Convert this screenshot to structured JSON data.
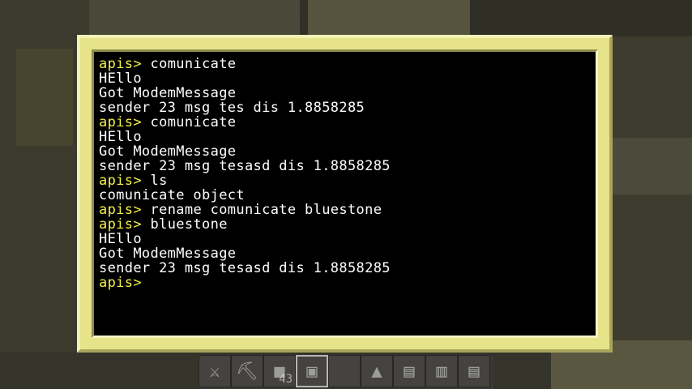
{
  "terminal": {
    "lines": [
      {
        "prompt": "apis>",
        "text": " comunicate"
      },
      {
        "prompt": "",
        "text": "HEllo"
      },
      {
        "prompt": "",
        "text": "Got ModemMessage"
      },
      {
        "prompt": "",
        "text": "sender 23 msg tes dis 1.8858285"
      },
      {
        "prompt": "apis>",
        "text": " comunicate"
      },
      {
        "prompt": "",
        "text": "HEllo"
      },
      {
        "prompt": "",
        "text": "Got ModemMessage"
      },
      {
        "prompt": "",
        "text": "sender 23 msg tesasd dis 1.8858285"
      },
      {
        "prompt": "apis>",
        "text": " ls"
      },
      {
        "prompt": "",
        "text": "comunicate object"
      },
      {
        "prompt": "apis>",
        "text": " rename comunicate bluestone"
      },
      {
        "prompt": "apis>",
        "text": " bluestone"
      },
      {
        "prompt": "",
        "text": "HEllo"
      },
      {
        "prompt": "",
        "text": "Got ModemMessage"
      },
      {
        "prompt": "",
        "text": "sender 23 msg tesasd dis 1.8858285"
      },
      {
        "prompt": "apis>",
        "text": ""
      }
    ]
  },
  "hotbar": {
    "slots": [
      {
        "icon": "sword-icon",
        "glyph": "⚔",
        "count": ""
      },
      {
        "icon": "pickaxe-icon",
        "glyph": "⛏",
        "count": ""
      },
      {
        "icon": "block-stack-icon",
        "glyph": "■",
        "count": "43"
      },
      {
        "icon": "computer-icon",
        "glyph": "▣",
        "count": "",
        "selected": true
      },
      {
        "icon": "empty-slot",
        "glyph": "",
        "count": ""
      },
      {
        "icon": "modem-icon",
        "glyph": "▲",
        "count": ""
      },
      {
        "icon": "chest-icon",
        "glyph": "▤",
        "count": ""
      },
      {
        "icon": "disk-drive-icon",
        "glyph": "▥",
        "count": ""
      },
      {
        "icon": "chest-icon",
        "glyph": "▤",
        "count": ""
      }
    ]
  },
  "colors": {
    "monitor_frame": "#e6e38a",
    "prompt": "#f4f04a",
    "text": "#ffffff",
    "screen_bg": "#000000"
  }
}
